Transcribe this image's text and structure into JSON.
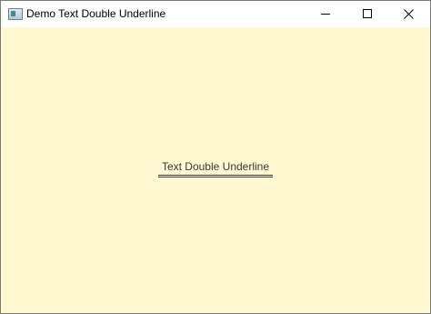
{
  "window": {
    "title": "Demo Text Double Underline",
    "background_color": "#fff8d0",
    "titlebar_color": "#ffffff"
  },
  "titlebar": {
    "icon": "app-window-icon",
    "buttons": [
      {
        "name": "minimize",
        "icon": "minimize-icon"
      },
      {
        "name": "maximize",
        "icon": "maximize-icon"
      },
      {
        "name": "close",
        "icon": "close-icon"
      }
    ]
  },
  "content": {
    "text": "Text Double Underline",
    "text_color": "#3a3a3a",
    "decoration": "double underline"
  }
}
